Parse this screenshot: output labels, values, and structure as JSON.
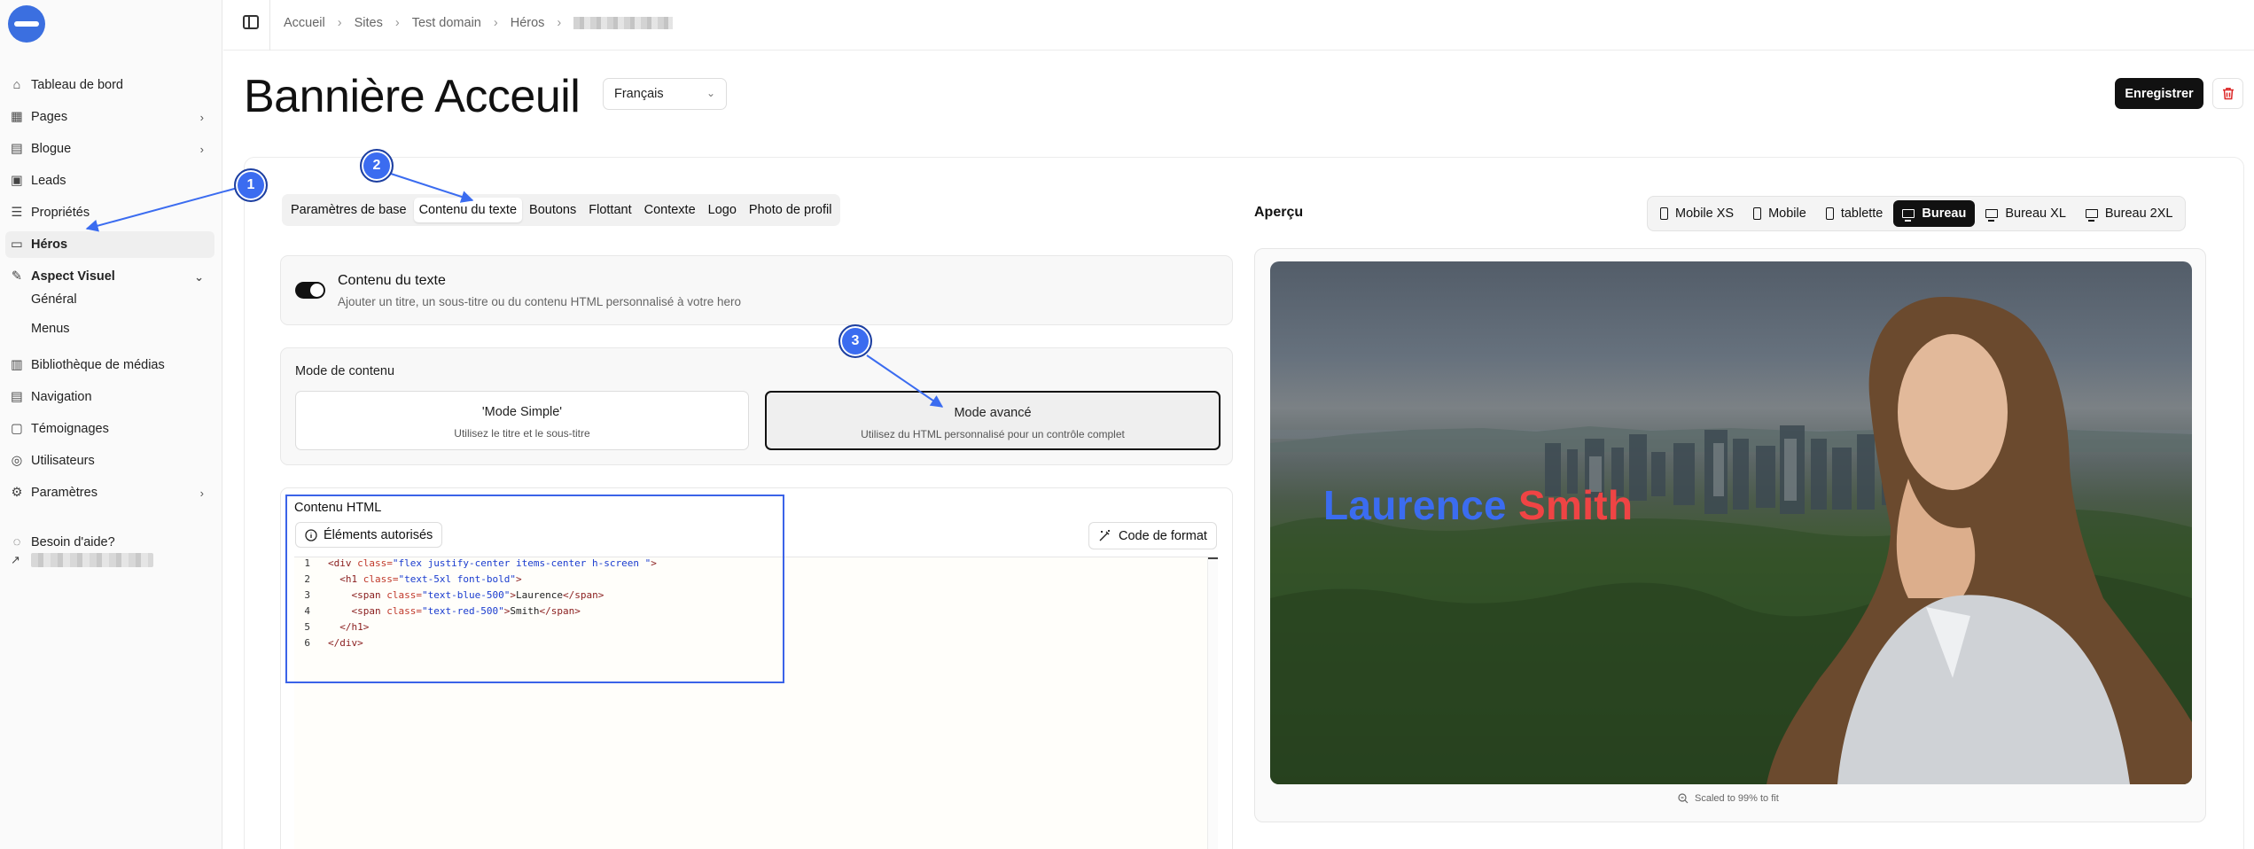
{
  "sidebar": {
    "items": [
      {
        "label": "Tableau de bord",
        "icon": "home-icon"
      },
      {
        "label": "Pages",
        "icon": "pages-icon",
        "has_children": true
      },
      {
        "label": "Blogue",
        "icon": "blog-icon",
        "has_children": true
      },
      {
        "label": "Leads",
        "icon": "leads-icon"
      },
      {
        "label": "Propriétés",
        "icon": "list-icon"
      },
      {
        "label": "Héros",
        "icon": "hero-icon",
        "active": true
      },
      {
        "label": "Aspect Visuel",
        "icon": "palette-icon",
        "expanded": true
      },
      {
        "label": "Bibliothèque de médias",
        "icon": "media-icon"
      },
      {
        "label": "Navigation",
        "icon": "navigation-icon"
      },
      {
        "label": "Témoignages",
        "icon": "testimonials-icon"
      },
      {
        "label": "Utilisateurs",
        "icon": "users-icon"
      },
      {
        "label": "Paramètres",
        "icon": "settings-icon",
        "has_children": true
      },
      {
        "label": "Besoin d'aide?",
        "icon": "help-icon"
      }
    ],
    "sub_items": [
      "Général",
      "Menus"
    ]
  },
  "breadcrumb": [
    "Accueil",
    "Sites",
    "Test domain",
    "Héros"
  ],
  "page": {
    "title": "Bannière Acceuil",
    "language": "Français",
    "save_label": "Enregistrer"
  },
  "tabs": [
    "Paramètres de base",
    "Contenu du texte",
    "Boutons",
    "Flottant",
    "Contexte",
    "Logo",
    "Photo de profil"
  ],
  "text_content": {
    "title": "Contenu du texte",
    "description": "Ajouter un titre, un sous-titre ou du contenu HTML personnalisé à votre hero",
    "enabled": true
  },
  "content_mode": {
    "label": "Mode de contenu",
    "simple": {
      "title": "'Mode Simple'",
      "subtitle": "Utilisez le titre et le sous-titre"
    },
    "advanced": {
      "title": "Mode avancé",
      "subtitle": "Utilisez du HTML personnalisé pour un contrôle complet",
      "selected": true
    }
  },
  "html_content": {
    "title": "Contenu HTML",
    "allowed_label": "Éléments autorisés",
    "format_label": "Code de format",
    "code_lines": [
      {
        "n": "1",
        "indent": "",
        "parts": [
          [
            "tag",
            "<div "
          ],
          [
            "attr",
            "class="
          ],
          [
            "str",
            "\"flex justify-center items-center h-screen \""
          ],
          [
            "tag",
            ">"
          ]
        ]
      },
      {
        "n": "2",
        "indent": "  ",
        "parts": [
          [
            "tag",
            "<h1 "
          ],
          [
            "attr",
            "class="
          ],
          [
            "str",
            "\"text-5xl font-bold\""
          ],
          [
            "tag",
            ">"
          ]
        ]
      },
      {
        "n": "3",
        "indent": "    ",
        "parts": [
          [
            "tag",
            "<span "
          ],
          [
            "attr",
            "class="
          ],
          [
            "str",
            "\"text-blue-500\""
          ],
          [
            "tag",
            ">"
          ],
          [
            "txt",
            "Laurence"
          ],
          [
            "tag",
            "</span>"
          ]
        ]
      },
      {
        "n": "4",
        "indent": "    ",
        "parts": [
          [
            "tag",
            "<span "
          ],
          [
            "attr",
            "class="
          ],
          [
            "str",
            "\"text-red-500\""
          ],
          [
            "tag",
            ">"
          ],
          [
            "txt",
            "Smith"
          ],
          [
            "tag",
            "</span>"
          ]
        ]
      },
      {
        "n": "5",
        "indent": "  ",
        "parts": [
          [
            "tag",
            "</h1>"
          ]
        ]
      },
      {
        "n": "6",
        "indent": "",
        "parts": [
          [
            "tag",
            "</div>"
          ]
        ]
      }
    ]
  },
  "preview": {
    "title": "Aperçu",
    "devices": [
      {
        "label": "Mobile XS",
        "kind": "phone"
      },
      {
        "label": "Mobile",
        "kind": "phone"
      },
      {
        "label": "tablette",
        "kind": "phone"
      },
      {
        "label": "Bureau",
        "kind": "desk",
        "active": true
      },
      {
        "label": "Bureau XL",
        "kind": "desk"
      },
      {
        "label": "Bureau 2XL",
        "kind": "desk"
      }
    ],
    "hero_first": "Laurence",
    "hero_last": "Smith",
    "scaled_note": "Scaled to 99% to fit"
  },
  "annotations": [
    "1",
    "2",
    "3"
  ],
  "colors": {
    "accent": "#3b6cf0",
    "hero_blue": "#3b6cf0",
    "hero_red": "#ef4444",
    "delete": "#dc2626"
  }
}
